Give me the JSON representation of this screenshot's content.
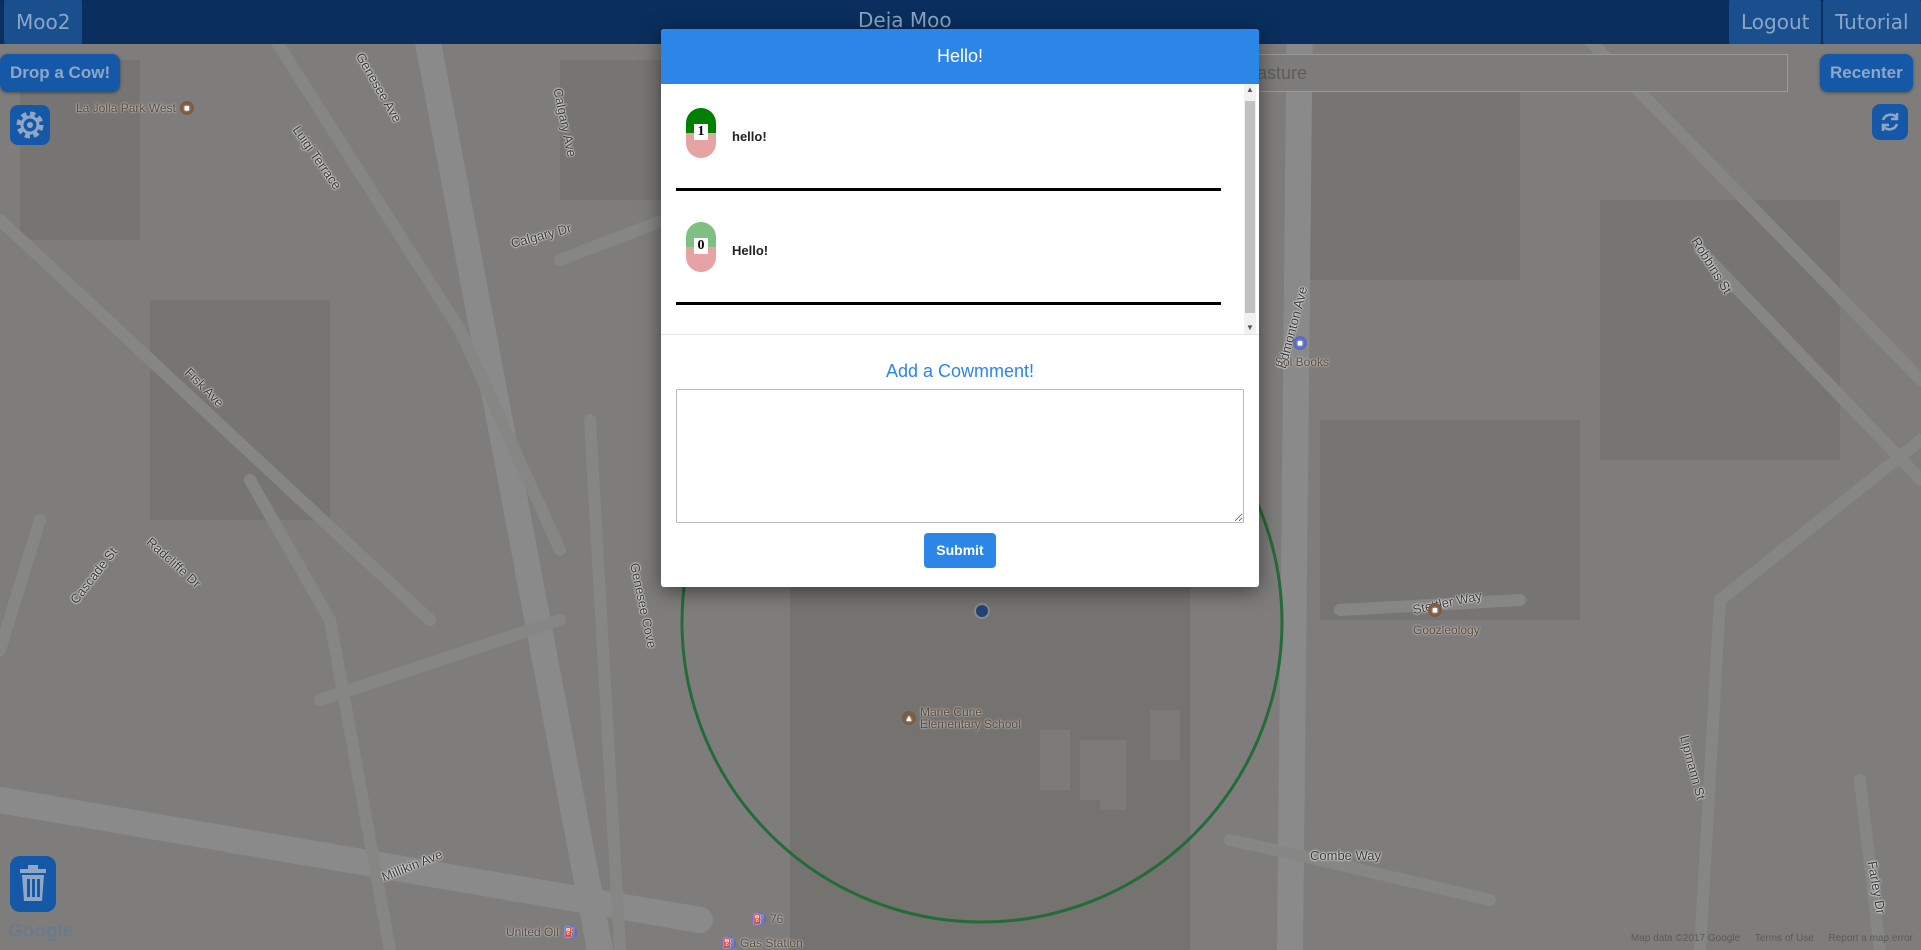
{
  "header": {
    "left_button": "Moo2",
    "title": "Deja Moo",
    "logout_label": "Logout",
    "tutorial_label": "Tutorial"
  },
  "controls": {
    "drop_cow_label": "Drop a Cow!",
    "recenter_label": "Recenter",
    "search_placeholder": "asture",
    "settings_icon": "gear-icon",
    "refresh_icon": "refresh-icon",
    "trash_icon": "trash-icon"
  },
  "modal": {
    "title": "Hello!",
    "comments": [
      {
        "votes": "1",
        "text": "hello!",
        "up_color": "#008000",
        "down_color": "#e5a3a3"
      },
      {
        "votes": "0",
        "text": "Hello!",
        "up_color": "#7fbf7f",
        "down_color": "#e5a3a3"
      }
    ],
    "add_comment_title": "Add a Cowmment!",
    "textarea_value": "",
    "submit_label": "Submit"
  },
  "map": {
    "street_labels": [
      "La Jolla Park West",
      "Luigi Terrace",
      "Genesee Ave",
      "Calgary Ave",
      "Calgary Dr",
      "Fisk Ave",
      "Radcliffe Dr",
      "Cascade St",
      "Genesee Cove",
      "Millikin Ave",
      "Edmonton Ave",
      "Stettler Way",
      "Combe Way",
      "Lipmann St",
      "Robbins St",
      "Farley Dr",
      "Marie Curie Elementary School",
      "Sol Books",
      "Goozleology",
      "United Oil",
      "Gas Station",
      "76"
    ],
    "google_logo": "Google",
    "map_data": "Map data ©2017 Google",
    "terms": "Terms of Use",
    "report": "Report a map error"
  }
}
